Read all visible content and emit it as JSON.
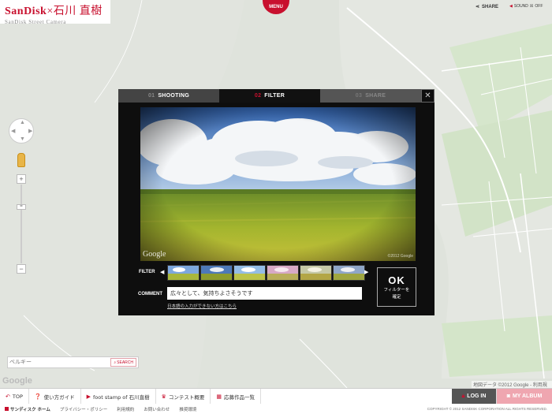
{
  "header": {
    "logo_brand": "SanDisk",
    "logo_collab": "×石川 直樹",
    "logo_sub": "SanDisk Street Camera",
    "menu_label": "MENU",
    "share_label": "SHARE",
    "sound_label": "SOUND",
    "sound_state": "OFF"
  },
  "map": {
    "search_placeholder": "ベルギー",
    "search_button": "SEARCH",
    "google_logo": "Google",
    "attribution": "地図データ ©2012 Google - 利用規約"
  },
  "modal": {
    "tabs": [
      {
        "num": "01",
        "label": "SHOOTING"
      },
      {
        "num": "02",
        "label": "FILTER"
      },
      {
        "num": "03",
        "label": "SHARE"
      }
    ],
    "active_tab": "FILTER",
    "photo": {
      "watermark": "Google",
      "copyright": "©2012 Google"
    },
    "filter_label": "FILTER",
    "filters": [
      "filter-1",
      "filter-2",
      "filter-3",
      "filter-4",
      "filter-5",
      "filter-6"
    ],
    "comment_label": "COMMENT",
    "comment_value": "広々として、気持ちよさそうです",
    "comment_link": "日本語の入力ができない方はこちら",
    "ok_big": "OK",
    "ok_line1": "フィルターを",
    "ok_line2": "確定"
  },
  "footer": {
    "items": [
      {
        "label": "TOP",
        "icon": "arrow-back-icon"
      },
      {
        "label": "使い方ガイド",
        "icon": "help-icon"
      },
      {
        "label": "foot stamp of 石川直樹",
        "icon": "video-icon"
      },
      {
        "label": "コンテスト概要",
        "icon": "trophy-icon"
      },
      {
        "label": "応募作品一覧",
        "icon": "grid-icon"
      }
    ],
    "login": "LOG IN",
    "album": "MY ALBUM"
  },
  "subfooter": {
    "home": "サンディスク ホーム",
    "links": [
      "プライバシー・ポリシー",
      "利用規約",
      "お問い合わせ",
      "推奨環境"
    ],
    "copyright": "COPYRIGHT © 2012 SANDISK CORPORATION ALL RIGHTS RESERVED."
  },
  "colors": {
    "brand": "#c8102e",
    "modal_bg": "#0e0e0e",
    "album": "#efa6b0"
  }
}
